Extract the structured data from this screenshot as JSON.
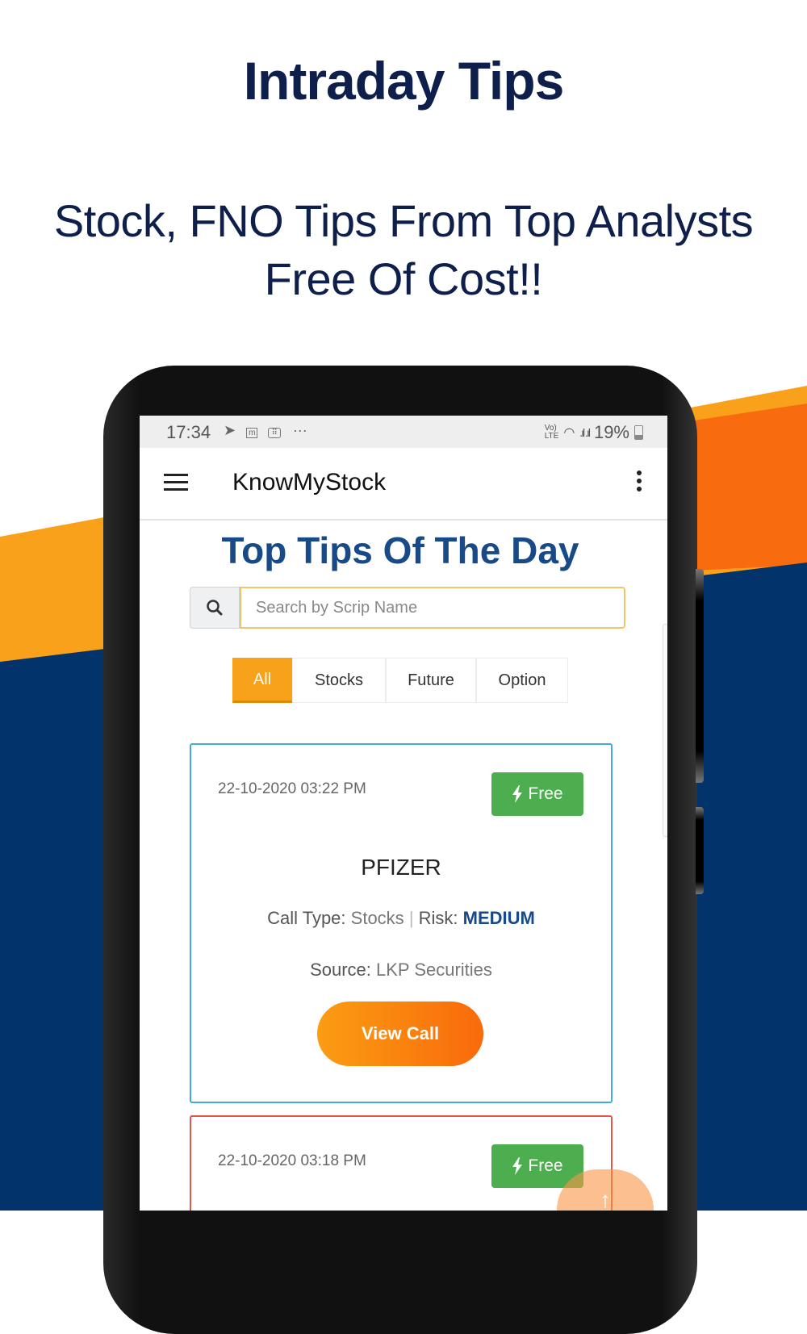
{
  "promo": {
    "title": "Intraday Tips",
    "subtitle_line1": "Stock, FNO Tips From Top Analysts",
    "subtitle_line2": "Free Of Cost!!"
  },
  "colors": {
    "navy": "#02336A",
    "yellow": "#F9A11B",
    "orange": "#F96B0F",
    "heading_blue": "#174A86",
    "free_green": "#4CAE4F"
  },
  "statusbar": {
    "time": "17:34",
    "left_icons": [
      "telegram-icon",
      "mail-icon",
      "calculator-icon",
      "more-icon"
    ],
    "network": "VoLTE",
    "battery": "19%"
  },
  "appbar": {
    "title": "KnowMyStock",
    "menu_icon": "hamburger-icon",
    "overflow_icon": "kebab-icon"
  },
  "page": {
    "heading": "Top Tips Of The Day",
    "search": {
      "placeholder": "Search by Scrip Name",
      "value": "",
      "icon": "search-icon"
    },
    "tabs": [
      {
        "label": "All",
        "active": true
      },
      {
        "label": "Stocks",
        "active": false
      },
      {
        "label": "Future",
        "active": false
      },
      {
        "label": "Option",
        "active": false
      }
    ]
  },
  "tips": [
    {
      "date": "22-10-2020 03:22 PM",
      "badge": "Free",
      "name": "PFIZER",
      "call_type_label": "Call Type:",
      "call_type": "Stocks",
      "separator": "|",
      "risk_label": "Risk:",
      "risk": "MEDIUM",
      "source_label": "Source:",
      "source": "LKP Securities",
      "button": "View Call"
    },
    {
      "date": "22-10-2020 03:18 PM",
      "badge": "Free"
    }
  ],
  "fab": {
    "icon": "arrow-up-icon",
    "label": "↑"
  }
}
